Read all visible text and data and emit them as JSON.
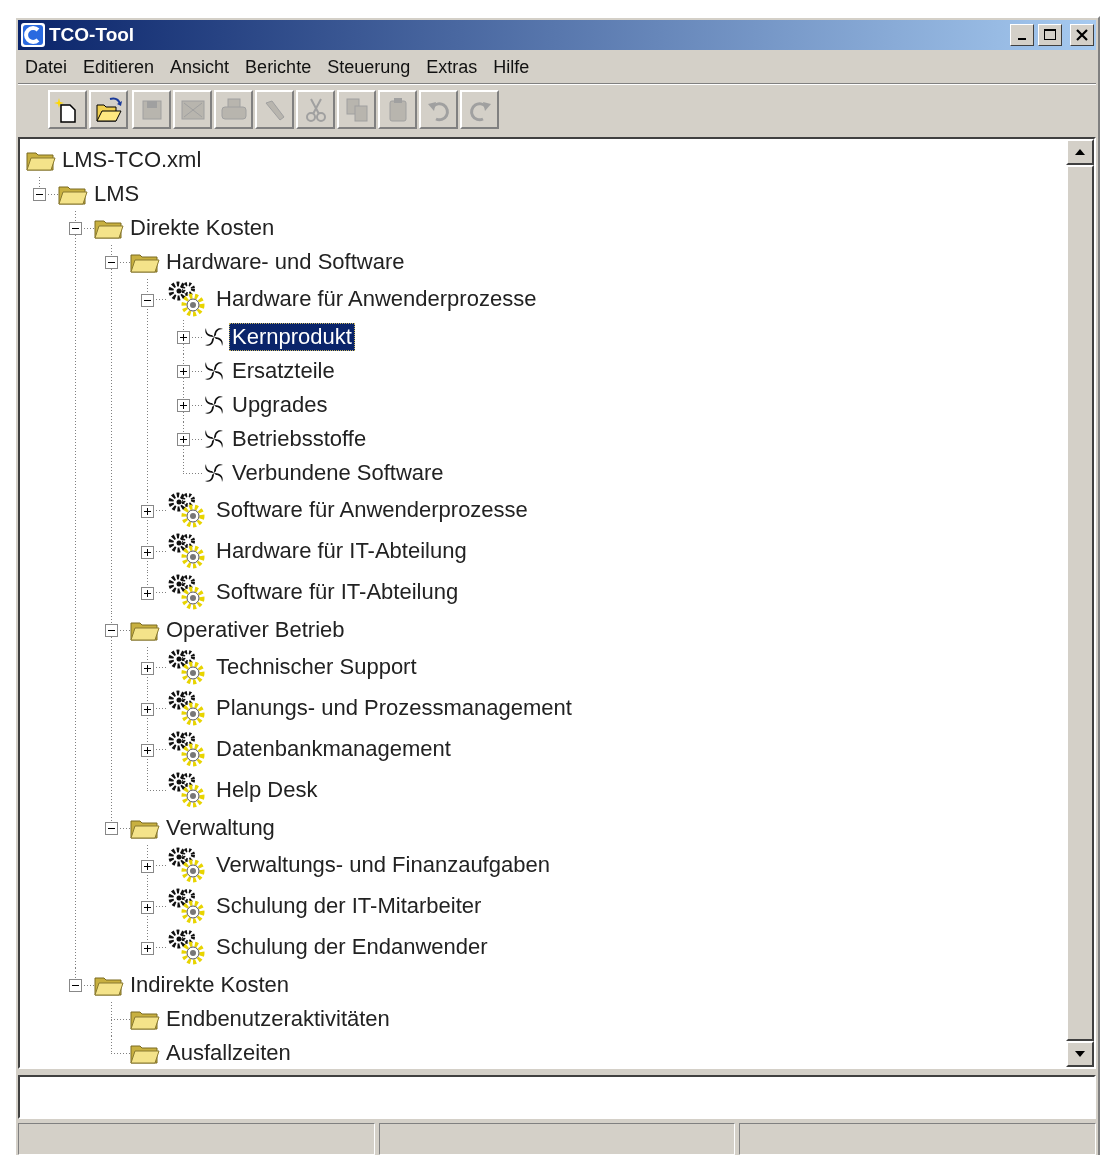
{
  "window": {
    "title": "TCO-Tool"
  },
  "menu": [
    "Datei",
    "Editieren",
    "Ansicht",
    "Berichte",
    "Steuerung",
    "Extras",
    "Hilfe"
  ],
  "toolbar": [
    {
      "kind": "new",
      "disabled": false
    },
    {
      "kind": "open",
      "disabled": false
    },
    {
      "kind": "save",
      "disabled": true
    },
    {
      "kind": "close",
      "disabled": true
    },
    {
      "kind": "print",
      "disabled": true
    },
    {
      "kind": "tool",
      "disabled": true
    },
    {
      "kind": "cut",
      "disabled": true
    },
    {
      "kind": "copy",
      "disabled": true
    },
    {
      "kind": "paste",
      "disabled": true
    },
    {
      "kind": "undo",
      "disabled": true
    },
    {
      "kind": "redo",
      "disabled": true
    }
  ],
  "tree": {
    "label": "LMS-TCO.xml",
    "kind": "folder",
    "selected": false,
    "children": [
      {
        "label": "LMS",
        "kind": "folder",
        "expanded": true,
        "selected": false,
        "children": [
          {
            "label": "Direkte Kosten",
            "kind": "folder",
            "expanded": true,
            "selected": false,
            "children": [
              {
                "label": "Hardware- und Software",
                "kind": "folder",
                "expanded": true,
                "selected": false,
                "children": [
                  {
                    "label": "Hardware für Anwenderprozesse",
                    "kind": "gear",
                    "expanded": true,
                    "selected": false,
                    "children": [
                      {
                        "label": "Kernprodukt",
                        "kind": "spiral",
                        "expanded": false,
                        "selected": true
                      },
                      {
                        "label": "Ersatzteile",
                        "kind": "spiral",
                        "expanded": false,
                        "selected": false
                      },
                      {
                        "label": "Upgrades",
                        "kind": "spiral",
                        "expanded": false,
                        "selected": false
                      },
                      {
                        "label": "Betriebsstoffe",
                        "kind": "spiral",
                        "expanded": false,
                        "selected": false
                      },
                      {
                        "label": "Verbundene Software",
                        "kind": "spiral",
                        "selected": false
                      }
                    ]
                  },
                  {
                    "label": "Software für Anwenderprozesse",
                    "kind": "gear",
                    "expanded": false,
                    "selected": false
                  },
                  {
                    "label": "Hardware für IT-Abteilung",
                    "kind": "gear",
                    "expanded": false,
                    "selected": false
                  },
                  {
                    "label": "Software für IT-Abteilung",
                    "kind": "gear",
                    "expanded": false,
                    "selected": false
                  }
                ]
              },
              {
                "label": "Operativer Betrieb",
                "kind": "folder",
                "expanded": true,
                "selected": false,
                "children": [
                  {
                    "label": "Technischer Support",
                    "kind": "gear",
                    "expanded": false,
                    "selected": false
                  },
                  {
                    "label": "Planungs- und Prozessmanagement",
                    "kind": "gear",
                    "expanded": false,
                    "selected": false
                  },
                  {
                    "label": "Datenbankmanagement",
                    "kind": "gear",
                    "expanded": false,
                    "selected": false
                  },
                  {
                    "label": "Help Desk",
                    "kind": "gear",
                    "selected": false
                  }
                ]
              },
              {
                "label": "Verwaltung",
                "kind": "folder",
                "expanded": true,
                "selected": false,
                "children": [
                  {
                    "label": "Verwaltungs- und Finanzaufgaben",
                    "kind": "gear",
                    "expanded": false,
                    "selected": false
                  },
                  {
                    "label": "Schulung der IT-Mitarbeiter",
                    "kind": "gear",
                    "expanded": false,
                    "selected": false
                  },
                  {
                    "label": "Schulung der Endanwender",
                    "kind": "gear",
                    "expanded": false,
                    "selected": false
                  }
                ]
              }
            ]
          },
          {
            "label": "Indirekte Kosten",
            "kind": "folder",
            "expanded": true,
            "selected": false,
            "children": [
              {
                "label": "Endbenutzeraktivitäten",
                "kind": "folder",
                "selected": false
              },
              {
                "label": "Ausfallzeiten",
                "kind": "folder",
                "selected": false
              }
            ]
          }
        ]
      }
    ]
  }
}
